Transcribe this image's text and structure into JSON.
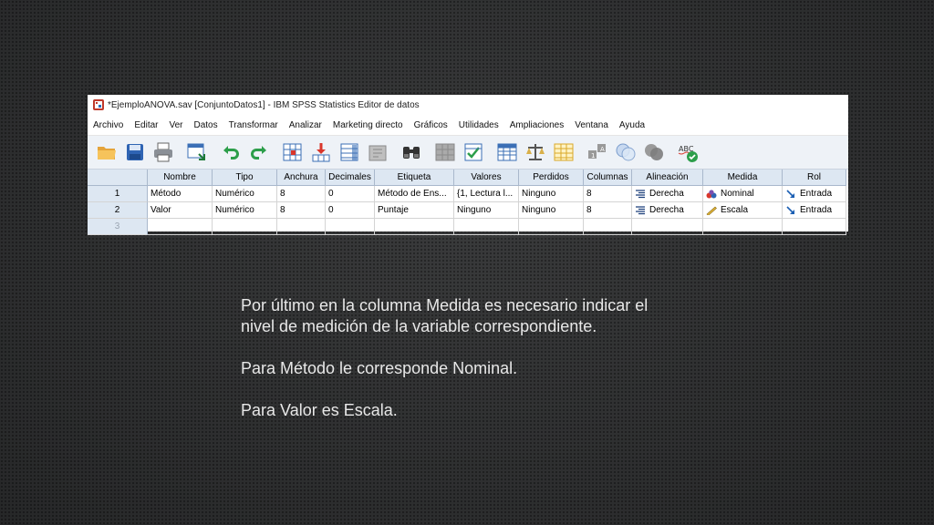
{
  "window": {
    "title": "*EjemploANOVA.sav [ConjuntoDatos1] - IBM SPSS Statistics Editor de datos"
  },
  "menu": [
    "Archivo",
    "Editar",
    "Ver",
    "Datos",
    "Transformar",
    "Analizar",
    "Marketing directo",
    "Gráficos",
    "Utilidades",
    "Ampliaciones",
    "Ventana",
    "Ayuda"
  ],
  "columns": [
    "Nombre",
    "Tipo",
    "Anchura",
    "Decimales",
    "Etiqueta",
    "Valores",
    "Perdidos",
    "Columnas",
    "Alineación",
    "Medida",
    "Rol"
  ],
  "rows": [
    {
      "num": "1",
      "nombre": "Método",
      "tipo": "Numérico",
      "anchura": "8",
      "decimales": "0",
      "etiqueta": "Método de Ens...",
      "valores": "{1, Lectura l...",
      "perdidos": "Ninguno",
      "columnas": "8",
      "alineacion": "Derecha",
      "medida": "Nominal",
      "rol": "Entrada"
    },
    {
      "num": "2",
      "nombre": "Valor",
      "tipo": "Numérico",
      "anchura": "8",
      "decimales": "0",
      "etiqueta": "Puntaje",
      "valores": "Ninguno",
      "perdidos": "Ninguno",
      "columnas": "8",
      "alineacion": "Derecha",
      "medida": "Escala",
      "rol": "Entrada"
    },
    {
      "num": "3"
    }
  ],
  "caption": {
    "line1": "Por último en la columna Medida es necesario indicar el",
    "line2": "nivel de medición de la variable correspondiente.",
    "line3": "Para Método le corresponde Nominal.",
    "line4": "Para Valor es Escala."
  },
  "toolbar_icons": [
    "open-folder-icon",
    "save-icon",
    "print-icon",
    "dialog-recall-icon",
    "undo-icon",
    "redo-icon",
    "goto-case-icon",
    "goto-variable-icon",
    "variables-icon",
    "run-descriptive-icon",
    "find-icon",
    "insert-cases-icon",
    "insert-variable-icon",
    "split-file-icon",
    "weight-cases-icon",
    "select-cases-icon",
    "value-labels-icon",
    "use-variable-sets-icon",
    "show-all-variables-icon",
    "spell-check-icon"
  ]
}
